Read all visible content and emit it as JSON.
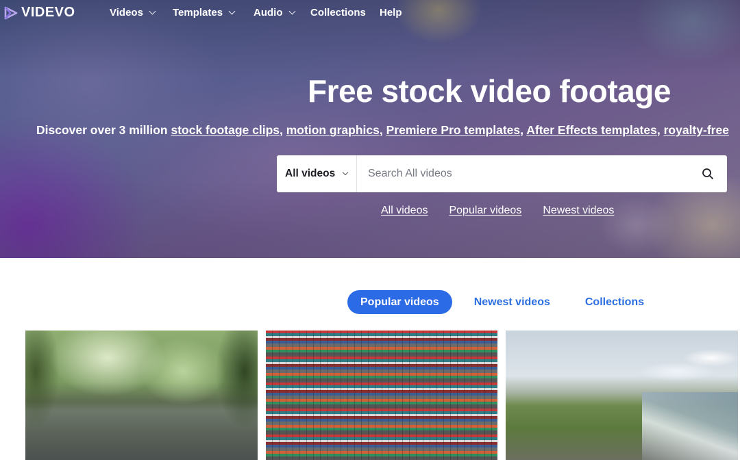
{
  "brand": {
    "name": "VIDEVO",
    "accent": "#2b6be6"
  },
  "nav": {
    "items": [
      {
        "label": "Videos",
        "has_dropdown": true
      },
      {
        "label": "Templates",
        "has_dropdown": true
      },
      {
        "label": "Audio",
        "has_dropdown": true
      },
      {
        "label": "Collections",
        "has_dropdown": false
      },
      {
        "label": "Help",
        "has_dropdown": false
      }
    ]
  },
  "hero": {
    "title": "Free stock video footage",
    "subtitle_prefix": "Discover over 3 million",
    "subtitle_links": [
      "stock footage clips",
      "motion graphics",
      "Premiere Pro templates",
      "After Effects templates",
      "royalty-free"
    ],
    "separator": ","
  },
  "search": {
    "scope_value": "All videos",
    "placeholder": "Search All videos",
    "icon": "search-icon"
  },
  "quick_links": [
    "All videos",
    "Popular videos",
    "Newest videos"
  ],
  "tabs": [
    {
      "label": "Popular videos",
      "active": true
    },
    {
      "label": "Newest videos",
      "active": false
    },
    {
      "label": "Collections",
      "active": false
    }
  ],
  "thumbnails": [
    {
      "subject": "rain drops on forest path"
    },
    {
      "subject": "aerial view of shipping containers"
    },
    {
      "subject": "rocky coastline with green hills"
    }
  ]
}
